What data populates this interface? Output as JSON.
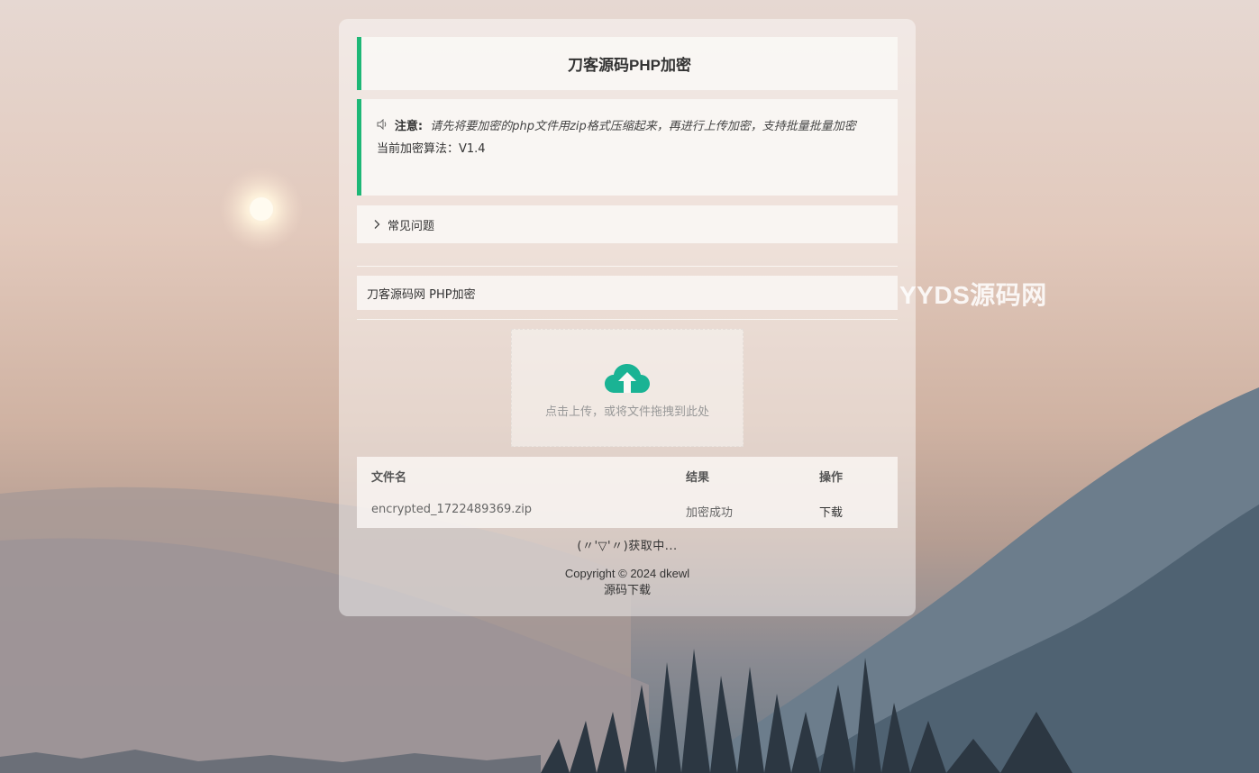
{
  "watermark": "YYDS源码网",
  "header": {
    "title": "刀客源码PHP加密"
  },
  "notice": {
    "icon": "speaker-icon",
    "label": "注意:",
    "message": "请先将要加密的php文件用zip格式压缩起来，再进行上传加密，支持批量批量加密",
    "algorithm": "当前加密算法：V1.4"
  },
  "faq": {
    "icon": "chevron-right-icon",
    "label": "常见问题"
  },
  "site_label": "刀客源码网 PHP加密",
  "upload": {
    "icon": "cloud-upload-icon",
    "hint": "点击上传，或将文件拖拽到此处",
    "accent": "#1ab394"
  },
  "table": {
    "headers": [
      "文件名",
      "结果",
      "操作"
    ],
    "rows": [
      {
        "filename": "encrypted_1722489369.zip",
        "result": "加密成功",
        "action": "下载"
      }
    ]
  },
  "loading_text": "(〃'▽'〃)获取中...",
  "footer": {
    "copyright": "Copyright © 2024 dkewl",
    "link": "源码下载"
  },
  "colors": {
    "accent_bar": "#1eb776",
    "upload_icon": "#1ab394"
  }
}
